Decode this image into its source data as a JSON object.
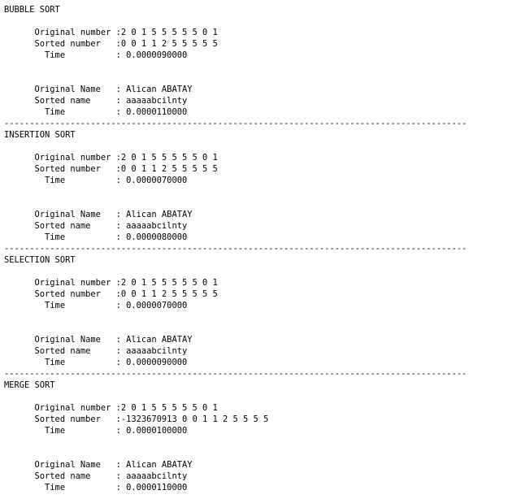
{
  "console": {
    "lines": [
      "BUBBLE SORT",
      "",
      "      Original number :2 0 1 5 5 5 5 5 0 1",
      "      Sorted number   :0 0 1 1 2 5 5 5 5 5",
      "        Time          : 0.0000090000",
      "",
      "",
      "      Original Name   : Alican ABATAY",
      "      Sorted name     : aaaaabcilnty",
      "        Time          : 0.0000110000",
      "-------------------------------------------------------------------------------------------",
      "INSERTION SORT",
      "",
      "      Original number :2 0 1 5 5 5 5 5 0 1",
      "      Sorted number   :0 0 1 1 2 5 5 5 5 5",
      "        Time          : 0.0000070000",
      "",
      "",
      "      Original Name   : Alican ABATAY",
      "      Sorted name     : aaaaabcilnty",
      "        Time          : 0.0000080000",
      "-------------------------------------------------------------------------------------------",
      "SELECTION SORT",
      "",
      "      Original number :2 0 1 5 5 5 5 5 0 1",
      "      Sorted number   :0 0 1 1 2 5 5 5 5 5",
      "        Time          : 0.0000070000",
      "",
      "",
      "      Original Name   : Alican ABATAY",
      "      Sorted name     : aaaaabcilnty",
      "        Time          : 0.0000090000",
      "-------------------------------------------------------------------------------------------",
      "MERGE SORT",
      "",
      "      Original number :2 0 1 5 5 5 5 5 0 1",
      "      Sorted number   :-1323670913 0 0 1 1 2 5 5 5 5",
      "        Time          : 0.0000100000",
      "",
      "",
      "      Original Name   : Alican ABATAY",
      "      Sorted name     : aaaaabcilnty",
      "        Time          : 0.0000110000"
    ]
  },
  "colors": {
    "background": "#ffffff",
    "text": "#000000"
  }
}
